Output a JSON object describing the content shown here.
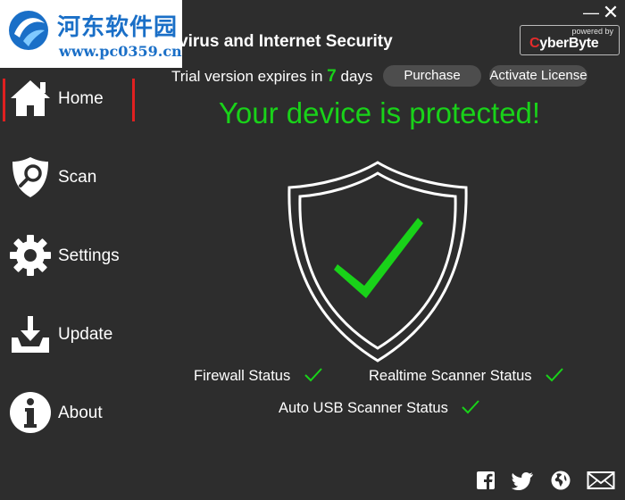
{
  "watermark": {
    "cn_text": "河东软件园",
    "url": "www.pc0359.cn"
  },
  "app": {
    "title": "virus and Internet Security",
    "powered_by": "powered by",
    "brand_prefix": "C",
    "brand_main": "yberByte"
  },
  "window_controls": {
    "minimize": "—",
    "close": "✕"
  },
  "trial": {
    "prefix": "Trial version expires in",
    "days": "7",
    "suffix": "days",
    "purchase_label": "Purchase",
    "activate_label": "Activate License"
  },
  "sidebar": {
    "items": [
      {
        "label": "Home",
        "icon": "home-icon",
        "active": true
      },
      {
        "label": "Scan",
        "icon": "shield-search-icon"
      },
      {
        "label": "Settings",
        "icon": "gear-icon"
      },
      {
        "label": "Update",
        "icon": "download-icon"
      },
      {
        "label": "About",
        "icon": "info-icon"
      }
    ]
  },
  "main": {
    "headline": "Your device is protected!",
    "statuses": [
      {
        "label": "Firewall Status",
        "ok": true
      },
      {
        "label": "Realtime Scanner Status",
        "ok": true
      },
      {
        "label": "Auto USB Scanner Status",
        "ok": true
      }
    ]
  },
  "social": [
    "facebook-icon",
    "twitter-icon",
    "globe-icon",
    "mail-icon"
  ],
  "colors": {
    "background": "#2d2d2d",
    "accent_green": "#19d219",
    "active_red": "#e02020",
    "pill": "#4d4d4d",
    "watermark_blue": "#1a6fc7"
  }
}
